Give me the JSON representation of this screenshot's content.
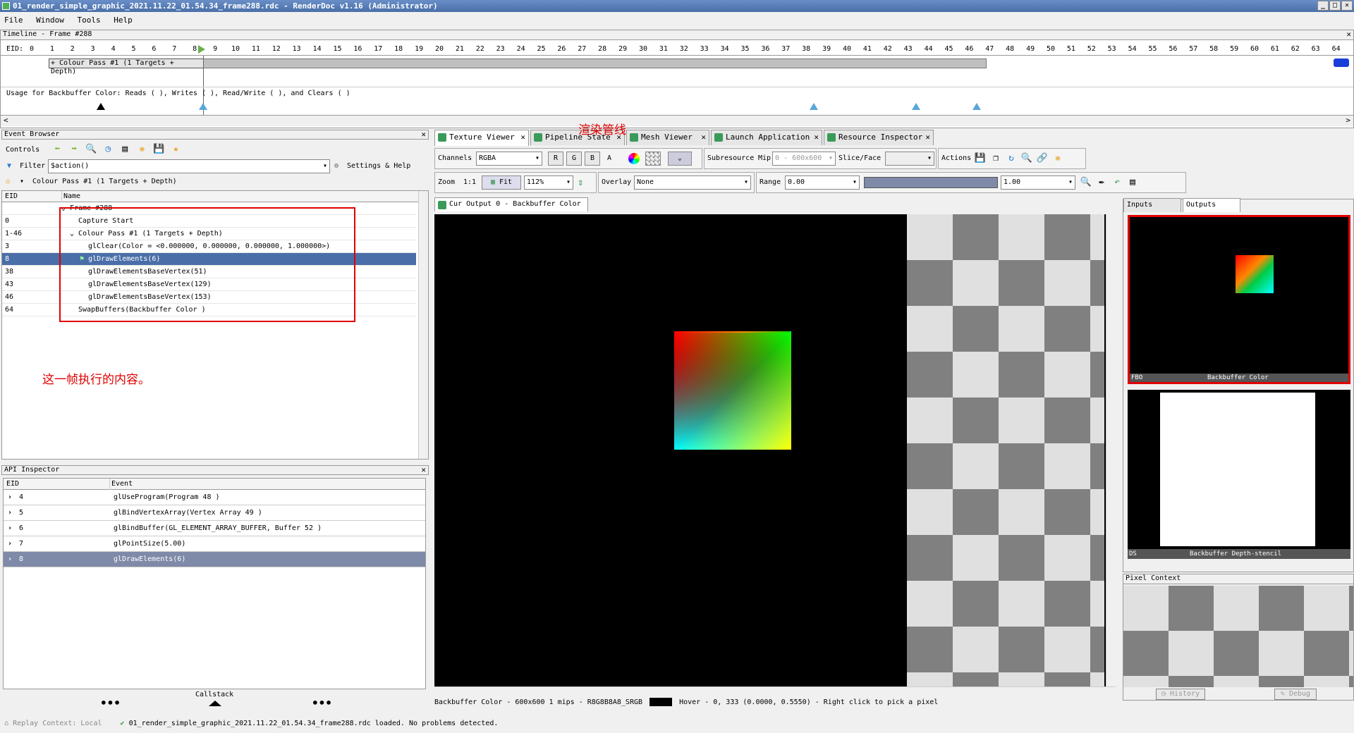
{
  "window": {
    "title": "01_render_simple_graphic_2021.11.22_01.54.34_frame288.rdc - RenderDoc v1.16 (Administrator)"
  },
  "menu": [
    "File",
    "Window",
    "Tools",
    "Help"
  ],
  "timeline": {
    "title": "Timeline - Frame #288",
    "eid_label": "EID:",
    "ticks": [
      "0",
      "1",
      "2",
      "3",
      "4",
      "5",
      "6",
      "7",
      "8",
      "9",
      "10",
      "11",
      "12",
      "13",
      "14",
      "15",
      "16",
      "17",
      "18",
      "19",
      "20",
      "21",
      "22",
      "23",
      "24",
      "25",
      "26",
      "27",
      "28",
      "29",
      "30",
      "31",
      "32",
      "33",
      "34",
      "35",
      "36",
      "37",
      "38",
      "39",
      "40",
      "41",
      "42",
      "43",
      "44",
      "45",
      "46",
      "47",
      "48",
      "49",
      "50",
      "51",
      "52",
      "53",
      "54",
      "55",
      "56",
      "57",
      "58",
      "59",
      "60",
      "61",
      "62",
      "63",
      "64"
    ],
    "pass_label": "+ Colour Pass #1 (1 Targets + Depth)",
    "usage_text": "Usage for Backbuffer Color: Reads ( ), Writes ( ), Read/Write ( ), and Clears ( )"
  },
  "event_browser": {
    "title": "Event Browser",
    "controls_label": "Controls",
    "filter_label": "Filter",
    "filter_value": "$action()",
    "settings_label": "Settings & Help",
    "breadcrumb": "Colour Pass #1 (1 Targets + Depth)",
    "col_eid": "EID",
    "col_name": "Name",
    "rows": [
      {
        "eid": "",
        "name": "Frame #288"
      },
      {
        "eid": "0",
        "name": "Capture Start"
      },
      {
        "eid": "1-46",
        "name": "Colour Pass #1 (1 Targets + Depth)"
      },
      {
        "eid": "3",
        "name": "glClear(Color = <0.000000, 0.000000, 0.000000, 1.000000>)"
      },
      {
        "eid": "8",
        "name": "glDrawElements(6)"
      },
      {
        "eid": "38",
        "name": "glDrawElementsBaseVertex(51)"
      },
      {
        "eid": "43",
        "name": "glDrawElementsBaseVertex(129)"
      },
      {
        "eid": "46",
        "name": "glDrawElementsBaseVertex(153)"
      },
      {
        "eid": "64",
        "name": "SwapBuffers(Backbuffer Color )"
      }
    ],
    "annotation": "这一帧执行的内容。"
  },
  "api_inspector": {
    "title": "API Inspector",
    "col_eid": "EID",
    "col_event": "Event",
    "rows": [
      {
        "eid": "4",
        "event": "glUseProgram(Program 48 )"
      },
      {
        "eid": "5",
        "event": "glBindVertexArray(Vertex Array 49 )"
      },
      {
        "eid": "6",
        "event": "glBindBuffer(GL_ELEMENT_ARRAY_BUFFER,  Buffer 52 )"
      },
      {
        "eid": "7",
        "event": "glPointSize(5.00)"
      },
      {
        "eid": "8",
        "event": "glDrawElements(6)"
      }
    ],
    "callstack_label": "Callstack"
  },
  "tabs": [
    "Texture Viewer",
    "Pipeline State",
    "Mesh Viewer",
    "Launch Application",
    "Resource Inspector"
  ],
  "tab_annotation": "渲染管线",
  "texture_viewer": {
    "channels_label": "Channels",
    "channels_value": "RGBA",
    "r": "R",
    "g": "G",
    "b": "B",
    "a": "A",
    "subresource_label": "Subresource",
    "mip_label": "Mip",
    "mip_value": "0 - 600x600",
    "slice_label": "Slice/Face",
    "actions_label": "Actions",
    "zoom_label": "Zoom",
    "zoom_11": "1:1",
    "fit_label": "Fit",
    "zoom_value": "112%",
    "overlay_label": "Overlay",
    "overlay_value": "None",
    "range_label": "Range",
    "range_min": "0.00",
    "range_max": "1.00",
    "output_tab": "Cur Output 0 - Backbuffer Color",
    "status": "Backbuffer Color - 600x600 1 mips - R8G8B8A8_SRGB",
    "hover": "Hover -     0,  333 (0.0000, 0.5550)  - Right click to pick a pixel"
  },
  "right_panel": {
    "inputs_tab": "Inputs",
    "outputs_tab": "Outputs",
    "thumb1_left": "FBO",
    "thumb1_label": "Backbuffer Color",
    "thumb2_left": "DS",
    "thumb2_label": "Backbuffer Depth-stencil",
    "pixel_context_title": "Pixel Context",
    "history_btn": "History",
    "debug_btn": "Debug"
  },
  "statusbar": {
    "replay": "Replay Context: Local",
    "message": "01_render_simple_graphic_2021.11.22_01.54.34_frame288.rdc loaded. No problems detected."
  }
}
